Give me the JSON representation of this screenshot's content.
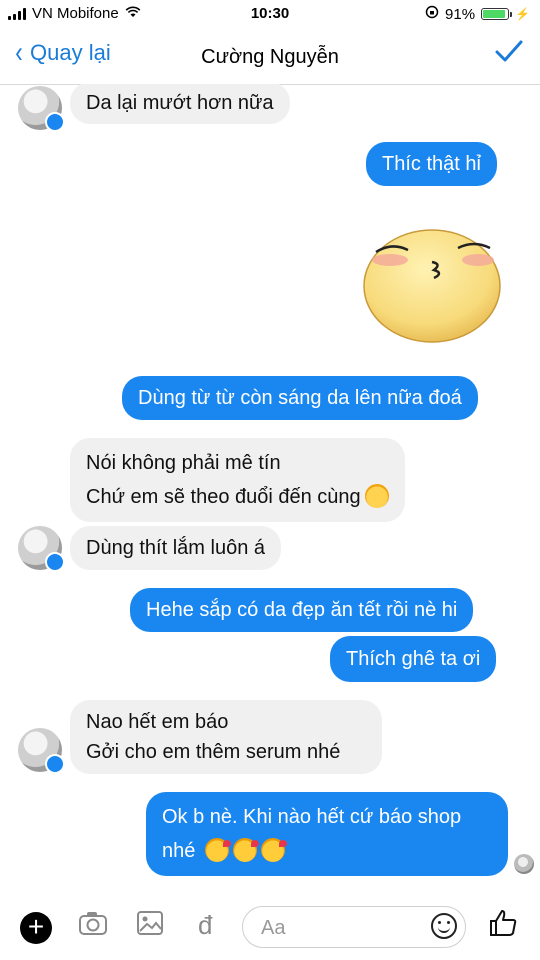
{
  "status_bar": {
    "carrier": "VN Mobifone",
    "time": "10:30",
    "battery": "91%",
    "battery_level": 0.91
  },
  "header": {
    "back_label": "Quay lại",
    "title": "Cường Nguyễn",
    "done_icon": "check-icon"
  },
  "messages": [
    {
      "id": "m1",
      "side": "in",
      "text": "Da lại mướt hơn nữa"
    },
    {
      "id": "m2",
      "side": "out",
      "text": "Thíc thật hỉ"
    },
    {
      "id": "m3",
      "side": "out",
      "sticker": "blushing-kiss-face"
    },
    {
      "id": "m4",
      "side": "out",
      "text": "Dùng từ từ còn sáng da lên nữa đoá"
    },
    {
      "id": "m5",
      "side": "in",
      "lines": [
        "Nói không phải mê tín",
        "Chứ em sẽ theo đuổi đến cùng"
      ]
    },
    {
      "id": "m6",
      "side": "in",
      "text": "Dùng thít lắm luôn á"
    },
    {
      "id": "m7",
      "side": "out",
      "text": "Hehe sắp có da đẹp ăn tết rồi nè hi"
    },
    {
      "id": "m8",
      "side": "out",
      "text": "Thích ghê ta ơi"
    },
    {
      "id": "m9",
      "side": "in",
      "lines": [
        "Nao hết em báo",
        "Gởi cho em thêm serum nhé"
      ]
    },
    {
      "id": "m10",
      "side": "out",
      "lines": [
        "Ok b nè. Khi nào hết cứ báo shop",
        "nhé"
      ]
    }
  ],
  "composer": {
    "placeholder": "Aa",
    "currency_symbol": "đ"
  },
  "colors": {
    "accent": "#1a87f0",
    "incoming": "#f1f0f0"
  }
}
